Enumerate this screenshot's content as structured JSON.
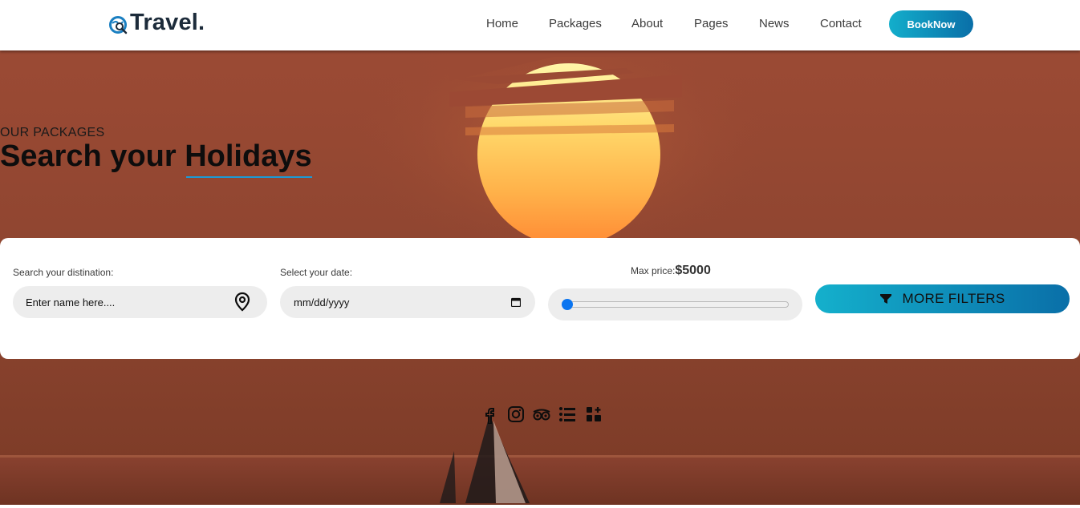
{
  "header": {
    "logo_text": "Travel.",
    "nav": [
      "Home",
      "Packages",
      "About",
      "Pages",
      "News",
      "Contact"
    ],
    "book_label": "BookNow"
  },
  "hero": {
    "subtitle": "OUR PACKAGES",
    "title_part1": "Search your ",
    "title_highlight": "Holidays"
  },
  "search": {
    "destination_label": "Search your distination:",
    "destination_placeholder": "Enter name here....",
    "date_label": "Select your date:",
    "date_placeholder": "mm/dd/yyyy",
    "price_label": "Max price:",
    "price_value": "$5000",
    "slider_fraction": 0.0,
    "filters_label": "MORE FILTERS"
  },
  "social_icons": [
    "facebook-icon",
    "instagram-icon",
    "tripadvisor-icon",
    "list-icon",
    "apps-icon"
  ],
  "colors": {
    "accent_start": "#13aecb",
    "accent_end": "#0a6fa8",
    "hero_bg": "#93462f",
    "slider_thumb": "#0b75f0"
  }
}
